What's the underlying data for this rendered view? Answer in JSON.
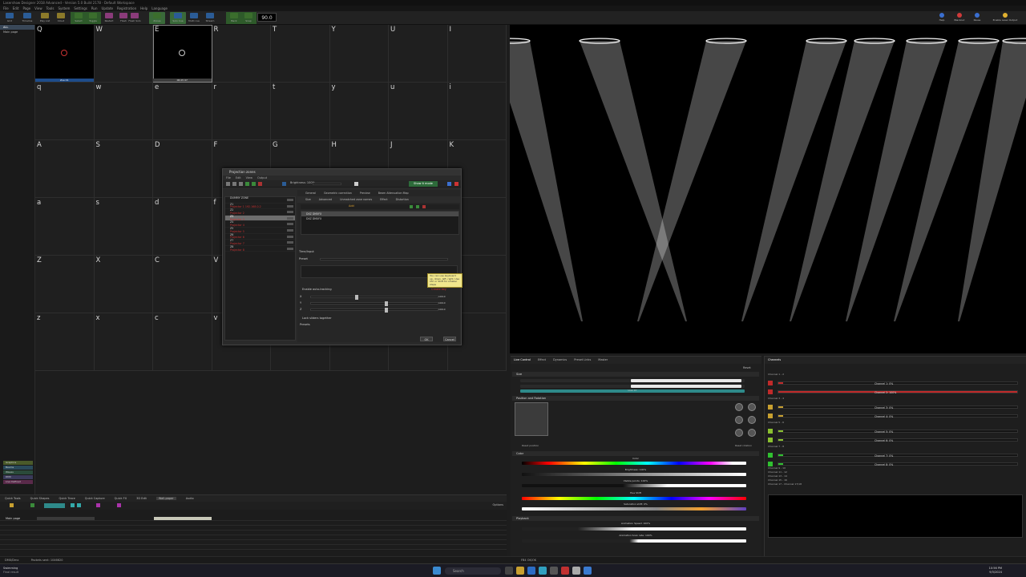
{
  "app": {
    "title": "Lasershow Designer 2018 Advanced - Version 5.0 Build 2178 - Default Workspace",
    "menu": [
      "File",
      "Edit",
      "Page",
      "View",
      "Tools",
      "System",
      "Settings",
      "Run",
      "Update",
      "Registration",
      "Help",
      "Language"
    ]
  },
  "toolbar": {
    "buttons": [
      {
        "label": "Grid",
        "variant": "blue"
      },
      {
        "label": "Timeline",
        "variant": "blue"
      },
      {
        "label": "Play List",
        "variant": "yel"
      },
      {
        "label": "Cloud",
        "variant": "yel"
      },
      {
        "label": "Select",
        "variant": "grn"
      },
      {
        "label": "Toggle",
        "variant": "grn"
      },
      {
        "label": "Restart",
        "variant": "pink"
      },
      {
        "label": "Flash",
        "variant": "pink"
      },
      {
        "label": "Flash Solo",
        "variant": "pink"
      },
      {
        "label": "Zones",
        "variant": "grn"
      },
      {
        "label": "Solo Cue",
        "variant": "blue"
      },
      {
        "label": "Multi cue",
        "variant": "blue"
      },
      {
        "label": "Stream",
        "variant": "blue"
      },
      {
        "label": "Back",
        "variant": "grn"
      },
      {
        "label": "Snap",
        "variant": "grn"
      }
    ],
    "bpm": "90.0",
    "right_buttons": [
      {
        "label": "Help",
        "color": "#3a6fd0"
      },
      {
        "label": "Blackout",
        "color": "#d03a3a"
      },
      {
        "label": "Pause",
        "color": "#3a6fd0"
      },
      {
        "label": "Enable Laser Output",
        "color": "#e0b030"
      }
    ]
  },
  "sidebar": {
    "items": [
      {
        "label": "ALL",
        "active": true
      },
      {
        "label": "Main page",
        "active": false
      }
    ],
    "footer": [
      {
        "label": "Graphics",
        "color": "#4a5a2a"
      },
      {
        "label": "Beams",
        "color": "#2a4a5a"
      },
      {
        "label": "Waves",
        "color": "#2a4a3a"
      },
      {
        "label": "DMX",
        "color": "#3a3a5a"
      },
      {
        "label": "Live Defined",
        "color": "#5a2a4a"
      }
    ]
  },
  "grid": {
    "cells": [
      {
        "key": "Q",
        "filled": true,
        "ring": "red",
        "label": "Zoe 01",
        "label_style": "blue"
      },
      {
        "key": "W"
      },
      {
        "key": "E",
        "filled": true,
        "selected": true,
        "ring": "white",
        "label": "06 05 07",
        "label_style": "gray"
      },
      {
        "key": "R"
      },
      {
        "key": "T"
      },
      {
        "key": "Y"
      },
      {
        "key": "U"
      },
      {
        "key": "I"
      },
      {
        "key": "q"
      },
      {
        "key": "w"
      },
      {
        "key": "e"
      },
      {
        "key": "r"
      },
      {
        "key": "t"
      },
      {
        "key": "y"
      },
      {
        "key": "u"
      },
      {
        "key": "i"
      },
      {
        "key": "A"
      },
      {
        "key": "S"
      },
      {
        "key": "D"
      },
      {
        "key": "F"
      },
      {
        "key": "G"
      },
      {
        "key": "H"
      },
      {
        "key": "J"
      },
      {
        "key": "K"
      },
      {
        "key": "a"
      },
      {
        "key": "s"
      },
      {
        "key": "d"
      },
      {
        "key": "f"
      },
      {
        "key": "g"
      },
      {
        "key": "h"
      },
      {
        "key": "j"
      },
      {
        "key": "k"
      },
      {
        "key": "Z"
      },
      {
        "key": "X"
      },
      {
        "key": "C"
      },
      {
        "key": "V"
      },
      {
        "key": "B"
      },
      {
        "key": "N"
      },
      {
        "key": "M"
      },
      {
        "key": ","
      },
      {
        "key": "z"
      },
      {
        "key": "x"
      },
      {
        "key": "c"
      },
      {
        "key": "v"
      },
      {
        "key": "b"
      },
      {
        "key": "n"
      },
      {
        "key": "m"
      },
      {
        "key": "."
      }
    ]
  },
  "dialog": {
    "title": "Projection zones",
    "menu": [
      "File",
      "Edit",
      "View",
      "Output"
    ],
    "brightness": "Brightness: 100%",
    "show_mode": "Show it mode",
    "zones": [
      {
        "name": "DUMMY ZONE",
        "sub": ""
      },
      {
        "name": "Z1",
        "sub": "Projector 1 192.168.0.2"
      },
      {
        "name": "Z2",
        "sub": "Projector 2"
      },
      {
        "name": "Z3",
        "sub": "Projector 3",
        "selected": true
      },
      {
        "name": "Z4",
        "sub": "Projector 4"
      },
      {
        "name": "Z5",
        "sub": "Projector 5"
      },
      {
        "name": "Z6",
        "sub": "Projector 6"
      },
      {
        "name": "Z7",
        "sub": "Projector 7"
      },
      {
        "name": "Z8",
        "sub": "Projector 8"
      }
    ],
    "tabs1": [
      "General",
      "Geometric correction",
      "Preview",
      "Beam Attenuation Map"
    ],
    "tabs2": [
      "Size",
      "Advanced",
      "Unmatched zone names",
      "Effect",
      "Distortion"
    ],
    "add_label": "Add",
    "effect_rows": [
      "DXZ DMXFX",
      "DXZ DMXFX"
    ],
    "timeinput": "Time/Input",
    "preset": "Preset",
    "enable_auto": "Enable auto-tracking",
    "create_key": "Create key",
    "axes": [
      "X",
      "Y",
      "Z"
    ],
    "axis_values": [
      "100.0",
      "100.0",
      "100.0"
    ],
    "lock_label": "Lock sliders together",
    "presets_label": "Presets",
    "tooltip": "You can use keyboard up, down, left, right. Use Ctrl or Shift for smaller steps",
    "ok": "OK",
    "cancel": "Cancel"
  },
  "timeline": {
    "tabs": [
      "Quick Tools",
      "Quick Shapes",
      "Quick Trace",
      "Quick Capture",
      "Quick FX",
      "3D Edit",
      "Wall-paper",
      "Audio"
    ],
    "active_tab": "Wall-paper",
    "rows": [
      "Main page",
      "",
      "",
      "",
      "",
      "",
      ""
    ],
    "options": "Options"
  },
  "live_panel": {
    "tabs": [
      "Live Control",
      "Effect",
      "Dynamics",
      "Preset Links",
      "Master"
    ],
    "reset": "Reset",
    "sec_size": "Size",
    "sec_pos": "Position and Rotation",
    "reset_position": "Reset position",
    "reset_rotation": "Reset rotation",
    "sec_color": "Color",
    "color_caps": [
      "Color",
      "Brightness: 100%",
      "Visible points: 100%",
      "Hue Shift",
      "Saturation shift: 0%"
    ],
    "sec_playback": "Playback",
    "playback_caps": [
      "Animation Speed: 100%",
      "Animation Scan rate: 100%"
    ],
    "link_label": "Link XY"
  },
  "channel_panel": {
    "title": "Channels",
    "groups": [
      "Channel 1 - 2",
      "Channel 3 - 4",
      "Channel 5 - 6",
      "Channel 7 - 8",
      "Channel 9 - 10",
      "Channel 11 - 12",
      "Channel 13 - 14",
      "Channel 15 - 16",
      "Channel 17 - Channel 17/18"
    ],
    "channels": [
      {
        "label": "Channel 1: 0%",
        "color": "#c02a2a",
        "fill": 0.02
      },
      {
        "label": "Channel 2: 100%",
        "color": "#c02a2a",
        "fill": 1.0
      },
      {
        "label": "Channel 3: 0%",
        "color": "#c8a030",
        "fill": 0.02
      },
      {
        "label": "Channel 4: 0%",
        "color": "#c8a030",
        "fill": 0.02
      },
      {
        "label": "Channel 5: 0%",
        "color": "#8ac030",
        "fill": 0.02
      },
      {
        "label": "Channel 6: 0%",
        "color": "#8ac030",
        "fill": 0.02
      },
      {
        "label": "Channel 7: 0%",
        "color": "#30c030",
        "fill": 0.02
      },
      {
        "label": "Channel 8: 0%",
        "color": "#30c030",
        "fill": 0.02
      }
    ]
  },
  "status": {
    "left": "DMX/Dmx",
    "middle": "Packets sent: 1046620",
    "swimming": "Swimming",
    "swimming_sub": "Final result",
    "zone_status": "FB4 OK/OK"
  },
  "taskbar": {
    "search": "Search",
    "time": "10:56 PM",
    "date": "9/3/2024"
  }
}
